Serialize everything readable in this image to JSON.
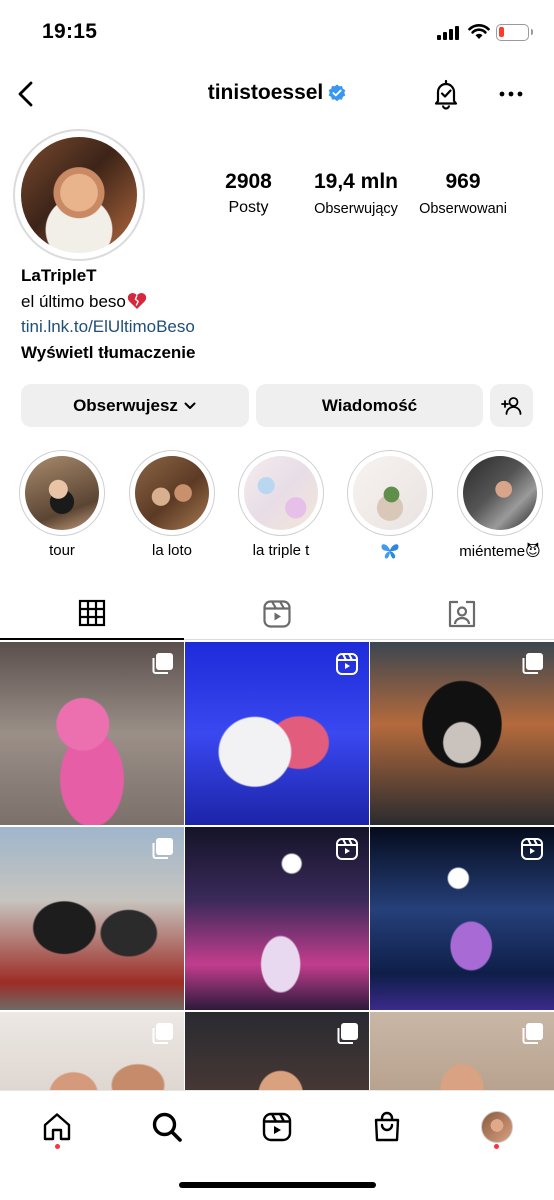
{
  "status_bar": {
    "time": "19:15"
  },
  "header": {
    "username": "tinistoessel"
  },
  "profile": {
    "stats": [
      {
        "value": "2908",
        "label": "Posty"
      },
      {
        "value": "19,4 mln",
        "label": "Obserwujący"
      },
      {
        "value": "969",
        "label": "Obserwowani"
      }
    ],
    "bio": {
      "name": "LaTripleT",
      "line1": "el último beso",
      "link": "tini.lnk.to/ElUltimoBeso",
      "translate": "Wyświetl tłumaczenie"
    }
  },
  "actions": {
    "follow_label": "Obserwujesz",
    "message_label": "Wiadomość"
  },
  "highlights": [
    {
      "label": "tour"
    },
    {
      "label": "la loto"
    },
    {
      "label": "la triple t"
    },
    {
      "label": "🦋"
    },
    {
      "label": "miénteme😈"
    }
  ],
  "colors": {
    "link": "#1f4e79",
    "verified": "#3897f0",
    "button_bg": "#efefef",
    "notification_dot": "#ff3040"
  },
  "icons": {
    "grid_tab": "grid-icon",
    "reels_tab": "reels-icon",
    "tagged_tab": "tagged-icon",
    "post_multi": "multiple-photos-icon",
    "post_reel": "reel-icon"
  }
}
